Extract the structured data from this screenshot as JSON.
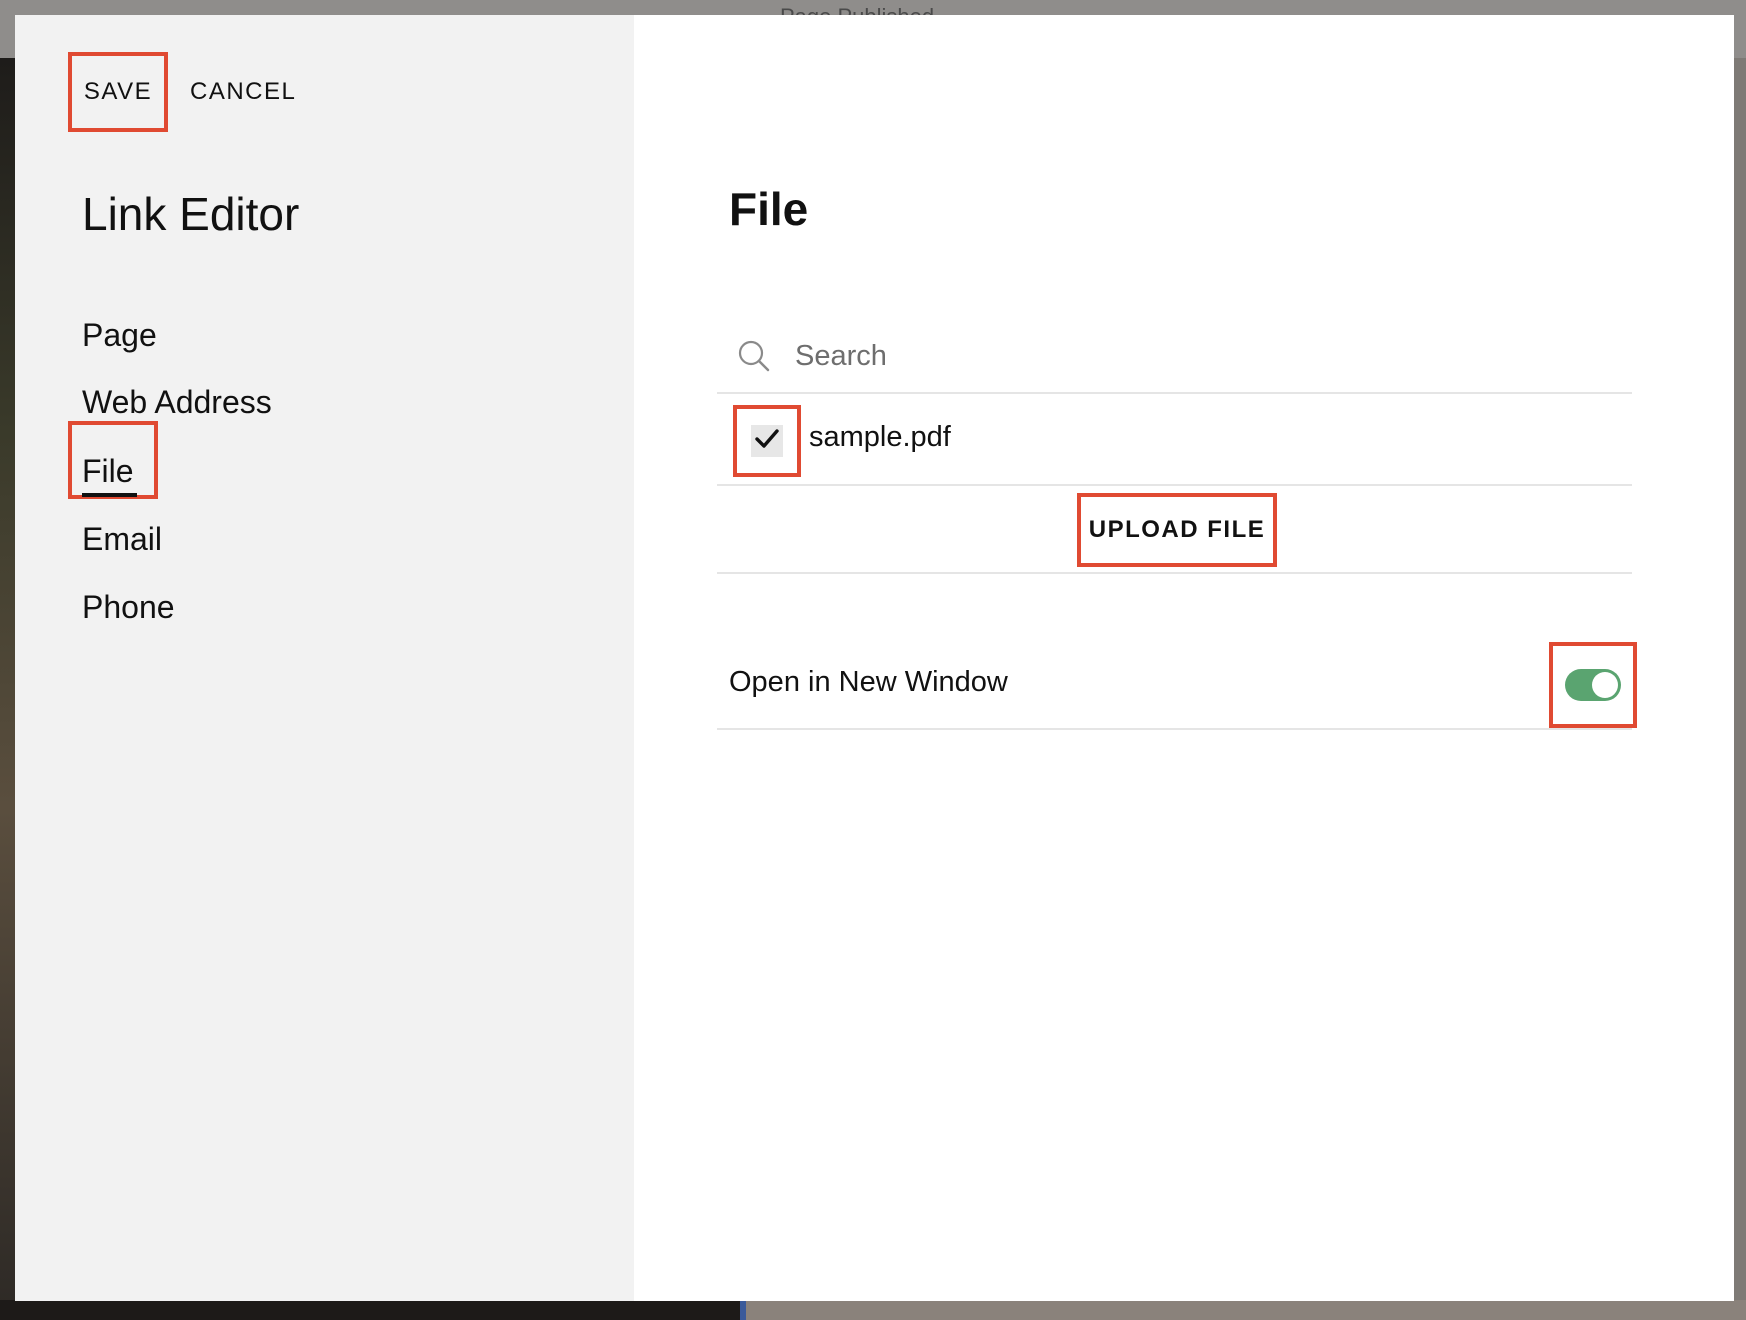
{
  "background": {
    "top_text": "Page Published"
  },
  "actions": {
    "save_label": "SAVE",
    "cancel_label": "CANCEL"
  },
  "sidebar": {
    "title": "Link Editor",
    "items": [
      {
        "label": "Page"
      },
      {
        "label": "Web Address"
      },
      {
        "label": "File",
        "selected": true
      },
      {
        "label": "Email"
      },
      {
        "label": "Phone"
      }
    ]
  },
  "main": {
    "title": "File",
    "search": {
      "placeholder": "Search",
      "value": ""
    },
    "files": [
      {
        "name": "sample.pdf",
        "checked": true
      }
    ],
    "upload_label": "UPLOAD FILE",
    "new_window": {
      "label": "Open in New Window",
      "enabled": true
    }
  },
  "icons": {
    "search": "search-icon",
    "check": "checkmark-icon"
  },
  "colors": {
    "highlight": "#e04a32",
    "toggle_on": "#5aa470",
    "sidebar_bg": "#f2f2f2"
  }
}
